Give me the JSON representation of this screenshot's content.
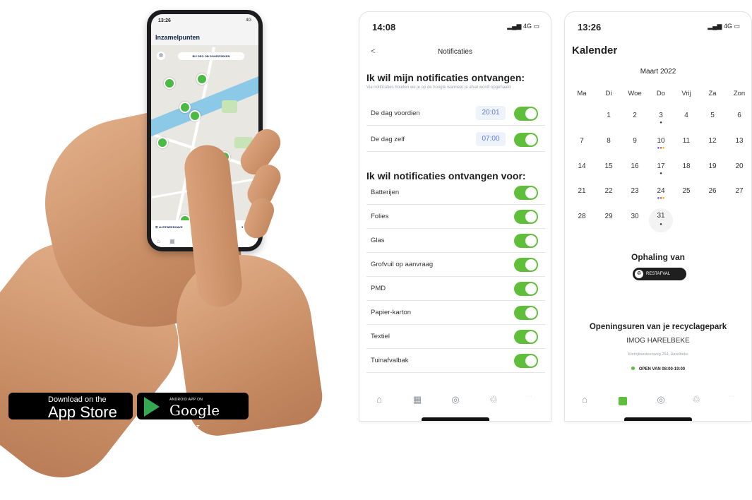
{
  "promo_phone": {
    "status_time": "13:26",
    "status_right": "4G",
    "title": "Inzamelpunten",
    "map_button": "BIJ GEO OB DOORZOEKEN",
    "list_label": "LIJSTWEERGAVE",
    "filter_label": "FILTER"
  },
  "badges": {
    "apple_small": "Download on the",
    "apple_big": "App Store",
    "google_small": "ANDROID APP ON",
    "google_big": "Google play"
  },
  "notifications_screen": {
    "status_time": "14:08",
    "status_right": "4G",
    "back_label": "<",
    "title": "Notificaties",
    "section1_title": "Ik wil mijn notificaties ontvangen:",
    "section1_sub": "Via notificaties houden we je op de hoogte wanneer je afval wordt opgehaald",
    "timing_rows": [
      {
        "label": "De dag voordien",
        "time": "20:01"
      },
      {
        "label": "De dag zelf",
        "time": "07:00"
      }
    ],
    "section2_title": "Ik wil notificaties ontvangen voor:",
    "categories": [
      "Batterijen",
      "Folies",
      "Glas",
      "Grofvuil op aanvraag",
      "PMD",
      "Papier-karton",
      "Textiel",
      "Tuinafvalbak"
    ],
    "tabs": [
      "⌂",
      "▦",
      "◎",
      "♲",
      "····"
    ]
  },
  "calendar_screen": {
    "status_time": "13:26",
    "status_right": "4G",
    "title": "Kalender",
    "month": "Maart 2022",
    "weekdays": [
      "Ma",
      "Di",
      "Woe",
      "Do",
      "Vrij",
      "Za",
      "Zon"
    ],
    "days": {
      "w1": [
        "1",
        "2",
        "3",
        "4",
        "5",
        "6"
      ],
      "w2": [
        "7",
        "8",
        "9",
        "10",
        "11",
        "12",
        "13"
      ],
      "w3": [
        "14",
        "15",
        "16",
        "17",
        "18",
        "19",
        "20"
      ],
      "w4": [
        "21",
        "22",
        "23",
        "24",
        "25",
        "26",
        "27"
      ],
      "w5": [
        "28",
        "29",
        "30",
        "31"
      ]
    },
    "pickup_title": "Ophaling van",
    "pickup_badge": "RESTAFVAL",
    "park_title": "Openingsuren van je recyclagepark",
    "park_name": "IMOG HARELBEKE",
    "park_address": "Kortrijksesteenweg 264, Harelbeke",
    "park_hours": "OPEN VAN 08:00-19:00",
    "tabs": [
      "⌂",
      "▦",
      "◎",
      "♲",
      "····"
    ]
  }
}
